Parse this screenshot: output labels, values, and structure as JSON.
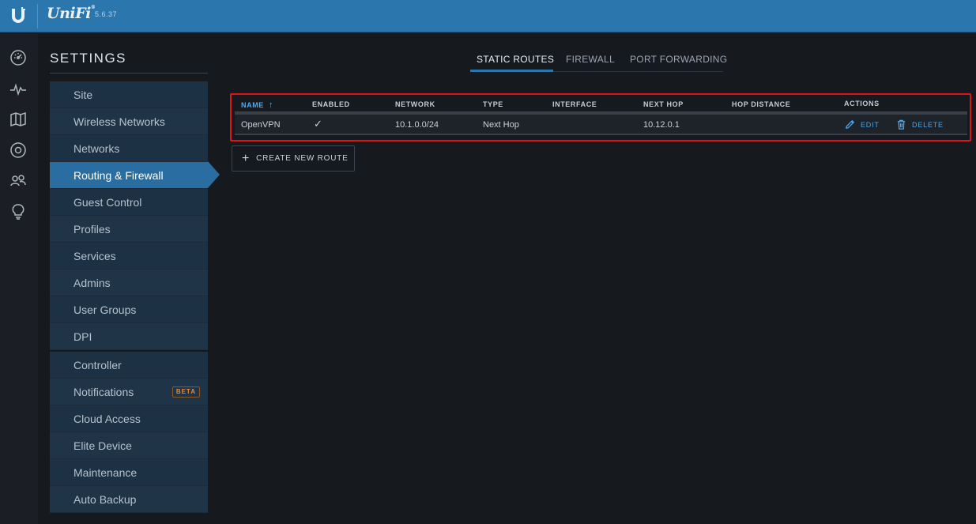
{
  "header": {
    "brand": "UniFi",
    "version": "5.6.37"
  },
  "rail": {
    "icons": [
      "dashboard-icon",
      "statistics-icon",
      "map-icon",
      "devices-icon",
      "clients-icon",
      "insights-icon"
    ]
  },
  "settings": {
    "title": "SETTINGS",
    "menu_group_1": [
      {
        "label": "Site"
      },
      {
        "label": "Wireless Networks"
      },
      {
        "label": "Networks"
      },
      {
        "label": "Routing & Firewall",
        "active": true
      },
      {
        "label": "Guest Control"
      },
      {
        "label": "Profiles"
      },
      {
        "label": "Services"
      },
      {
        "label": "Admins"
      },
      {
        "label": "User Groups"
      },
      {
        "label": "DPI"
      }
    ],
    "menu_group_2": [
      {
        "label": "Controller"
      },
      {
        "label": "Notifications",
        "badge": "BETA"
      },
      {
        "label": "Cloud Access"
      },
      {
        "label": "Elite Device"
      },
      {
        "label": "Maintenance"
      },
      {
        "label": "Auto Backup"
      }
    ]
  },
  "tabs": [
    {
      "label": "STATIC ROUTES",
      "active": true
    },
    {
      "label": "FIREWALL"
    },
    {
      "label": "PORT FORWARDING"
    }
  ],
  "routes_table": {
    "columns": [
      "NAME",
      "ENABLED",
      "NETWORK",
      "TYPE",
      "INTERFACE",
      "NEXT HOP",
      "HOP DISTANCE",
      "ACTIONS"
    ],
    "sort_indicator": "↑",
    "rows": [
      {
        "name": "OpenVPN",
        "enabled": "✓",
        "network": "10.1.0.0/24",
        "type": "Next Hop",
        "interface": "",
        "next_hop": "10.12.0.1",
        "hop_distance": "",
        "edit_label": "EDIT",
        "delete_label": "DELETE"
      }
    ]
  },
  "create_button": {
    "label": "CREATE NEW ROUTE"
  },
  "colors": {
    "topbar": "#2b77ad",
    "active_menu": "#2a6da0",
    "highlight_border": "#e01414",
    "action_blue": "#4aa3e8"
  }
}
